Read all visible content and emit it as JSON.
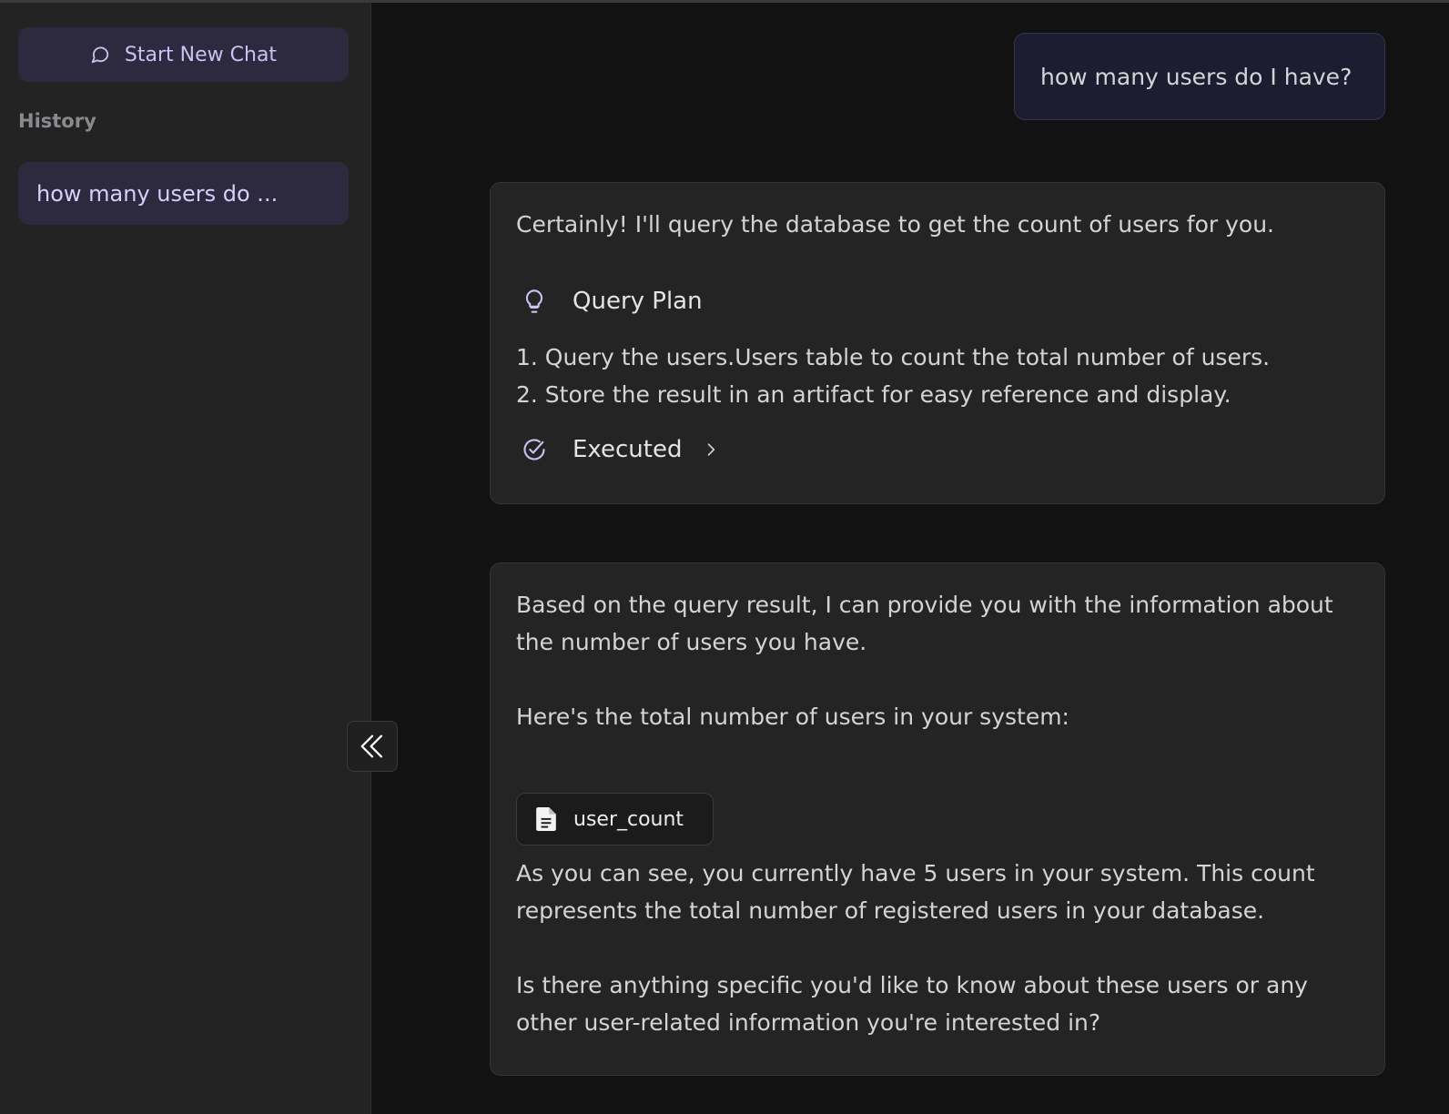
{
  "sidebar": {
    "new_chat_label": "Start New Chat",
    "history_label": "History",
    "history_items": [
      {
        "label": "how many users do ..."
      }
    ]
  },
  "chat": {
    "user_message": "how many users do I have?",
    "assistant_1": {
      "intro": "Certainly! I'll query the database to get the count of users for you.",
      "plan_title": "Query Plan",
      "steps": [
        "1. Query the users.Users table to count the total number of users.",
        "2. Store the result in an artifact for easy reference and display."
      ],
      "status": "Executed"
    },
    "assistant_2": {
      "p1": "Based on the query result, I can provide you with the information about the number of users you have.",
      "p2": "Here's the total number of users in your system:",
      "artifact_name": "user_count",
      "p3": "As you can see, you currently have 5 users in your system. This count represents the total number of registered users in your database.",
      "p4": "Is there anything specific you'd like to know about these users or any other user-related information you're interested in?"
    }
  },
  "icons": {
    "new_chat": "chat-bubble-icon",
    "plan": "lightbulb-icon",
    "status": "check-circle-icon",
    "expand": "chevron-right-icon",
    "artifact": "document-icon",
    "collapse": "double-chevron-left-icon"
  },
  "colors": {
    "accent": "#c9c2f2",
    "accent_bg": "#2d2a3f",
    "user_bubble": "#1c1d30",
    "card": "#242424"
  }
}
